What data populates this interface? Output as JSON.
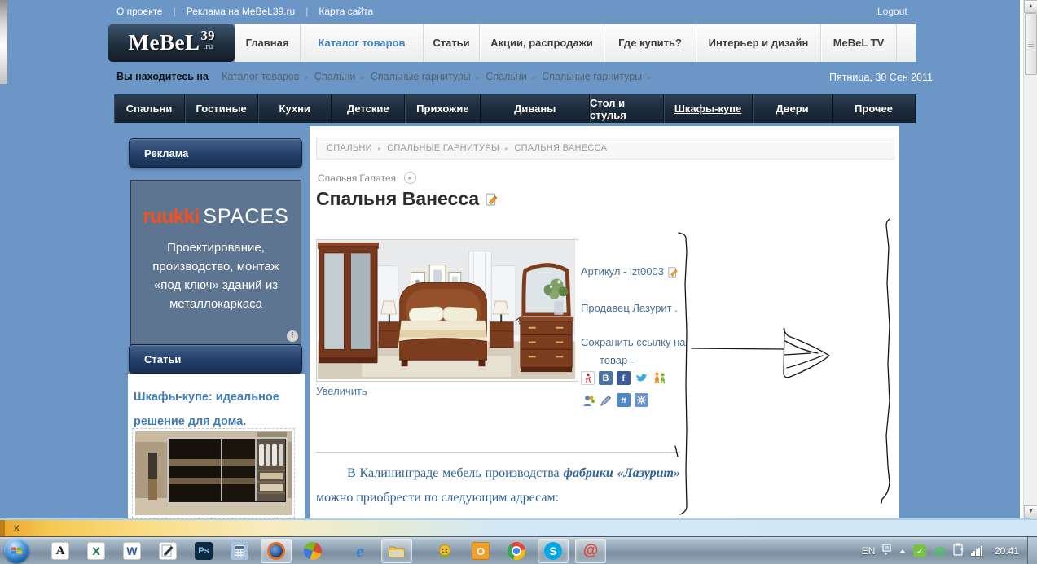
{
  "colors": {
    "page_bg": "#6C96C6",
    "brand_orange": "#F4511E",
    "link_blue": "#3F7CB8",
    "nav_dark": "#1E2C3B",
    "active_nav_blue": "#4285C5"
  },
  "top_bar": {
    "links": [
      "О проекте",
      "Реклама на MeBeL39.ru",
      "Карта сайта"
    ],
    "logout": "Logout"
  },
  "logo": {
    "name": "MeBeL",
    "number": "39",
    "tld": ".ru"
  },
  "main_nav": {
    "items": [
      {
        "label": "Главная"
      },
      {
        "label": "Каталог товаров"
      },
      {
        "label": "Статьи"
      },
      {
        "label": "Акции, распродажи"
      },
      {
        "label": "Где купить?"
      },
      {
        "label": "Интерьер и дизайн"
      },
      {
        "label": "MeBeL TV"
      }
    ]
  },
  "location_bar": {
    "prefix": "Вы находитесь на",
    "crumbs": [
      "Каталог товаров",
      "Спальни",
      "Спальные гарнитуры",
      "Спальни",
      "Спальные гарнитуры"
    ],
    "date": "Пятница, 30 Сен 2011"
  },
  "category_nav": {
    "items": [
      "Спальни",
      "Гостиные",
      "Кухни",
      "Детские",
      "Прихожие",
      "Диваны",
      "Стол и стулья",
      "Шкафы-купе",
      "Двери",
      "Прочее"
    ]
  },
  "sidebar": {
    "ads_header": "Реклама",
    "ad": {
      "brand_1": "ruukki",
      "brand_2": "SPACES",
      "text": "Проектирование, производство, монтаж «под ключ» зданий из металлокаркаса",
      "info": "i"
    },
    "articles_header": "Статьи",
    "article_title": "Шкафы-купе: идеальное решение для дома."
  },
  "content": {
    "breadcrumb": [
      "СПАЛЬНИ",
      "СПАЛЬНЫЕ ГАРНИТУРЫ",
      "СПАЛЬНЯ ВАНЕССА"
    ],
    "prev_link": "Спальня Галатея",
    "prev_arrow": "▸",
    "title": "Спальня Ванесса",
    "enlarge_link": "Увеличить",
    "sku": "Артикул - lzt0003",
    "seller_prefix": "Продавец",
    "seller_name": "Лазурит",
    "seller_dot": ".",
    "save_line_1": "Сохранить ссылку на",
    "save_line_2": "товар -",
    "paragraph": {
      "part1": "В Калининграде мебель производства ",
      "bold": "фабрики «Лазурит»",
      "part2": " можно приобрести по следующим адресам:"
    }
  },
  "share": {
    "vk": "B",
    "facebook": "f",
    "friendfeed": "ff"
  },
  "notification": {
    "close": "x"
  },
  "taskbar": {
    "letters": {
      "abbyy": "A",
      "excel": "X",
      "word": "W",
      "photoshop": "Ps",
      "ie": "e",
      "outlook": "O",
      "skype": "S",
      "mailru": "@"
    },
    "tray": {
      "lang": "EN",
      "time": "20:41"
    }
  }
}
